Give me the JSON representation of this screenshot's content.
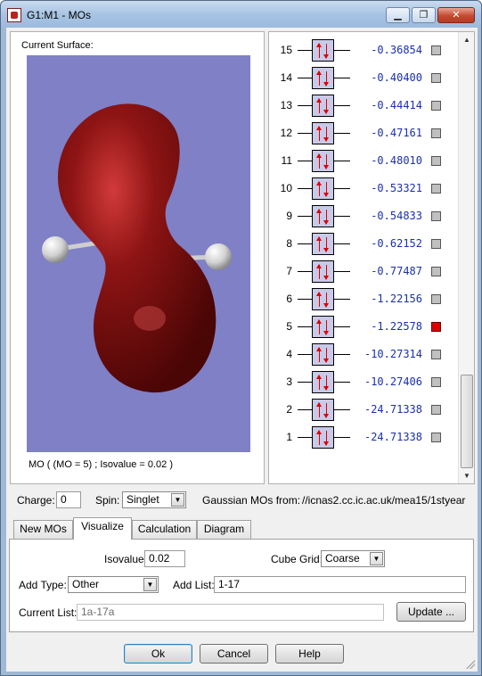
{
  "window": {
    "title": "G1:M1 - MOs",
    "minimize_label": "▁",
    "maximize_label": "❐",
    "close_label": "✕"
  },
  "surface": {
    "label": "Current Surface:",
    "caption": "MO ( (MO = 5) ; Isovalue = 0.02 )",
    "background_color": "#7f80c6",
    "lobe_color": "#7a0c0c"
  },
  "orbitals": [
    {
      "number": "15",
      "energy": "-0.36854",
      "selected": false
    },
    {
      "number": "14",
      "energy": "-0.40400",
      "selected": false
    },
    {
      "number": "13",
      "energy": "-0.44414",
      "selected": false
    },
    {
      "number": "12",
      "energy": "-0.47161",
      "selected": false
    },
    {
      "number": "11",
      "energy": "-0.48010",
      "selected": false
    },
    {
      "number": "10",
      "energy": "-0.53321",
      "selected": false
    },
    {
      "number": "9",
      "energy": "-0.54833",
      "selected": false
    },
    {
      "number": "8",
      "energy": "-0.62152",
      "selected": false
    },
    {
      "number": "7",
      "energy": "-0.77487",
      "selected": false
    },
    {
      "number": "6",
      "energy": "-1.22156",
      "selected": false
    },
    {
      "number": "5",
      "energy": "-1.22578",
      "selected": true
    },
    {
      "number": "4",
      "energy": "-10.27314",
      "selected": false
    },
    {
      "number": "3",
      "energy": "-10.27406",
      "selected": false
    },
    {
      "number": "2",
      "energy": "-24.71338",
      "selected": false
    },
    {
      "number": "1",
      "energy": "-24.71338",
      "selected": false
    }
  ],
  "charge": {
    "label": "Charge:",
    "value": "0"
  },
  "spin": {
    "label": "Spin:",
    "value": "Singlet"
  },
  "source": {
    "label": "Gaussian MOs from:",
    "path": "//icnas2.cc.ic.ac.uk/mea15/1styear"
  },
  "tabs": [
    {
      "label": "New MOs",
      "active": false
    },
    {
      "label": "Visualize",
      "active": true
    },
    {
      "label": "Calculation",
      "active": false
    },
    {
      "label": "Diagram",
      "active": false
    }
  ],
  "visualize": {
    "isovalue_label": "Isovalue:",
    "isovalue": "0.02",
    "cube_grid_label": "Cube Grid:",
    "cube_grid": "Coarse",
    "add_type_label": "Add Type:",
    "add_type": "Other",
    "add_list_label": "Add List:",
    "add_list": "1-17",
    "current_list_label": "Current List:",
    "current_list": "1a-17a",
    "update_label": "Update ..."
  },
  "buttons": {
    "ok": "Ok",
    "cancel": "Cancel",
    "help": "Help"
  },
  "colors": {
    "energy_text": "#1a2fb0",
    "electron_arrow": "#dd0000",
    "selected_marker": "#dd0000"
  }
}
